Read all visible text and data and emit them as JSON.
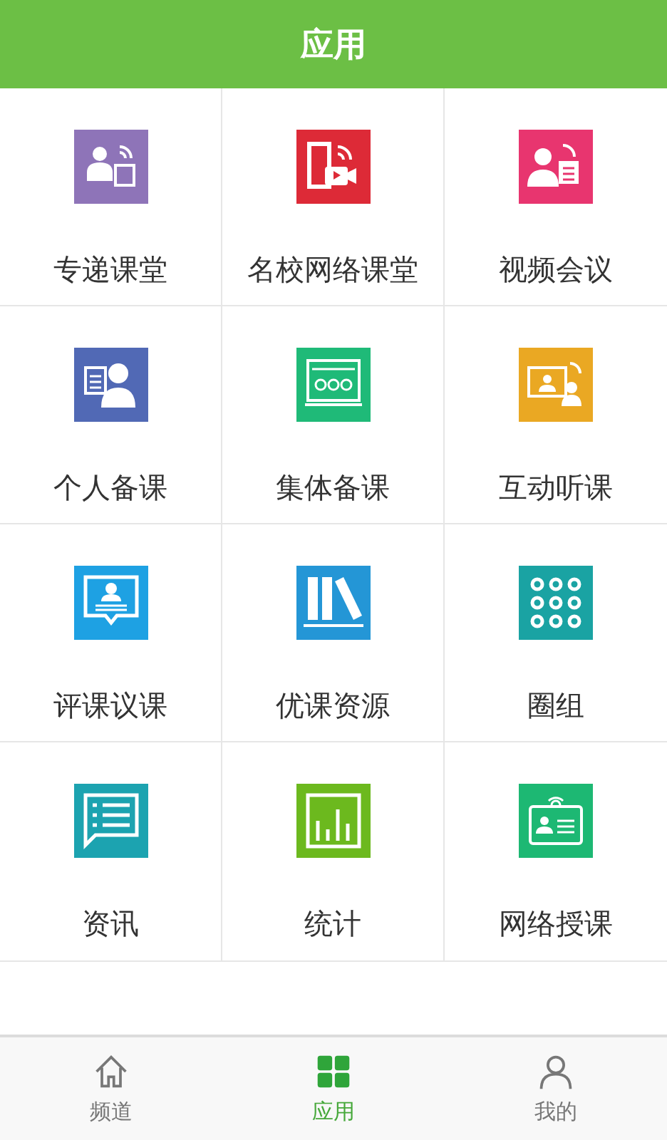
{
  "header": {
    "title": "应用"
  },
  "apps": [
    {
      "label": "专递课堂",
      "kind": "teacher",
      "color": "#8e74b8"
    },
    {
      "label": "名校网络课堂",
      "kind": "film",
      "color": "#dd2a37"
    },
    {
      "label": "视频会议",
      "kind": "meeting",
      "color": "#e8356f"
    },
    {
      "label": "个人备课",
      "kind": "notes",
      "color": "#5169b5"
    },
    {
      "label": "集体备课",
      "kind": "group",
      "color": "#1fba78"
    },
    {
      "label": "互动听课",
      "kind": "screen",
      "color": "#eaa823"
    },
    {
      "label": "评课议课",
      "kind": "comment",
      "color": "#1ea1e3"
    },
    {
      "label": "优课资源",
      "kind": "books",
      "color": "#2496d6"
    },
    {
      "label": "圈组",
      "kind": "dots",
      "color": "#1aa3a3"
    },
    {
      "label": "资讯",
      "kind": "list",
      "color": "#1ca3b0"
    },
    {
      "label": "统计",
      "kind": "chart",
      "color": "#6cb91e"
    },
    {
      "label": "网络授课",
      "kind": "badge",
      "color": "#1db873"
    }
  ],
  "tabs": [
    {
      "label": "频道",
      "kind": "home",
      "selected": false
    },
    {
      "label": "应用",
      "kind": "grid",
      "selected": true
    },
    {
      "label": "我的",
      "kind": "person",
      "selected": false
    }
  ]
}
